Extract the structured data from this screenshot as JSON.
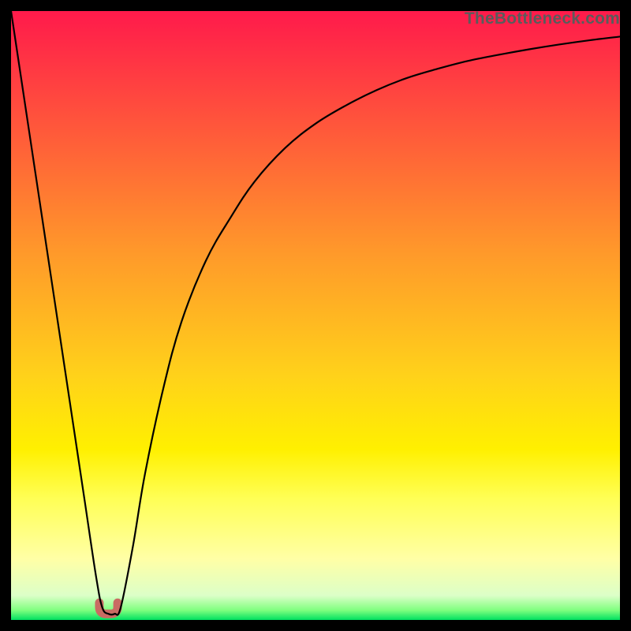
{
  "watermark": "TheBottleneck.com",
  "chart_data": {
    "type": "line",
    "title": "",
    "xlabel": "",
    "ylabel": "",
    "xlim": [
      0,
      100
    ],
    "ylim": [
      0,
      100
    ],
    "grid": false,
    "legend": false,
    "background_gradient": {
      "stops": [
        {
          "offset": 0.0,
          "color": "#ff1a4b"
        },
        {
          "offset": 0.2,
          "color": "#ff5a3a"
        },
        {
          "offset": 0.4,
          "color": "#ff9a2a"
        },
        {
          "offset": 0.6,
          "color": "#ffd21a"
        },
        {
          "offset": 0.72,
          "color": "#fff000"
        },
        {
          "offset": 0.8,
          "color": "#ffff55"
        },
        {
          "offset": 0.9,
          "color": "#ffffa6"
        },
        {
          "offset": 0.96,
          "color": "#dcffc8"
        },
        {
          "offset": 0.984,
          "color": "#7fff7f"
        },
        {
          "offset": 1.0,
          "color": "#00e060"
        }
      ]
    },
    "series": [
      {
        "name": "bottleneck-curve",
        "x": [
          0,
          2,
          4,
          6,
          8,
          10,
          12,
          14,
          15,
          16,
          17,
          18,
          20,
          22,
          25,
          28,
          32,
          36,
          40,
          45,
          50,
          55,
          60,
          65,
          70,
          75,
          80,
          85,
          90,
          95,
          100
        ],
        "y": [
          100,
          86.7,
          73.4,
          60.1,
          46.8,
          33.5,
          20.2,
          6.9,
          2.0,
          1.0,
          1.0,
          2.0,
          12.0,
          24.0,
          38.0,
          49.0,
          59.0,
          66.0,
          72.0,
          77.5,
          81.5,
          84.5,
          87.0,
          89.0,
          90.5,
          91.8,
          92.8,
          93.7,
          94.5,
          95.2,
          95.8
        ]
      }
    ],
    "sweet_spot": {
      "x_range": [
        14.5,
        17.5
      ],
      "y": 1.0,
      "color": "#c96b63"
    }
  }
}
